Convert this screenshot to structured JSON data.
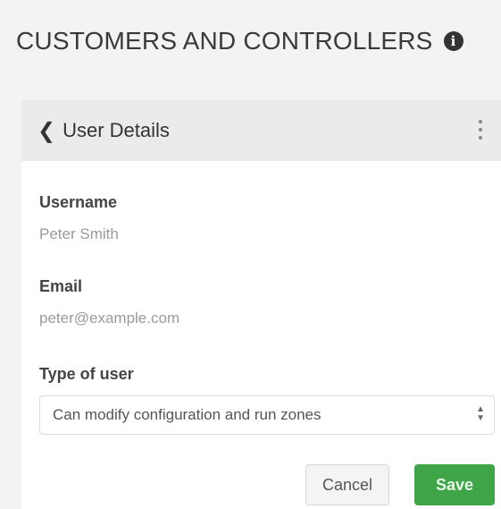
{
  "header": {
    "title": "CUSTOMERS AND CONTROLLERS",
    "info_icon": "i"
  },
  "card": {
    "title": "User Details",
    "back_icon": "❮",
    "menu_icon": "kebab-vertical"
  },
  "fields": {
    "username_label": "Username",
    "username_value": "Peter Smith",
    "email_label": "Email",
    "email_value": "peter@example.com",
    "type_label": "Type of user",
    "type_value": "Can modify configuration and run zones"
  },
  "buttons": {
    "cancel": "Cancel",
    "save": "Save"
  },
  "colors": {
    "save_button": "#3fa548",
    "card_header": "#ebebeb",
    "page_background": "#f3f3f3"
  }
}
